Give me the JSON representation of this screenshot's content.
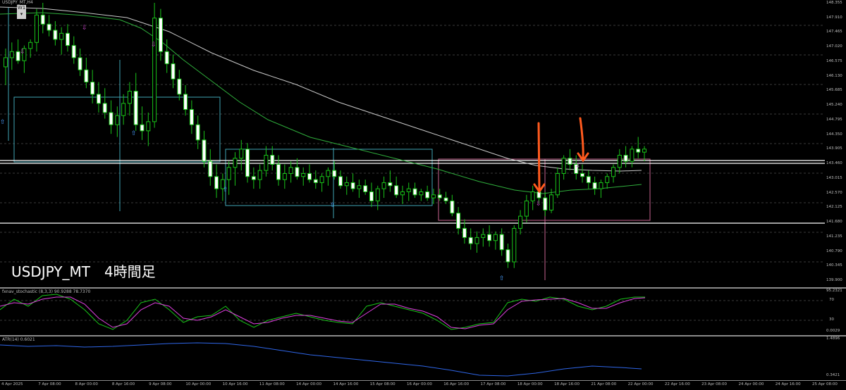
{
  "window": {
    "title": "USDJPY_MT,H4"
  },
  "timeframe": {
    "button_label": "W1"
  },
  "main": {
    "caption": "USDJPY_MT　4時間足",
    "price_labels": [
      "148.355",
      "147.910",
      "147.465",
      "147.020",
      "146.575",
      "146.130",
      "145.685",
      "145.240",
      "144.795",
      "144.350",
      "143.905",
      "143.460",
      "143.015",
      "142.570",
      "142.125",
      "141.680",
      "141.235",
      "140.790",
      "140.345",
      "139.900"
    ]
  },
  "stochastic": {
    "title": "fxnav_stochastic (8,3,3) 90.9288 78.7370",
    "axis_labels": [
      "95.2321",
      "70",
      "30",
      "0.0029"
    ],
    "main_color": "#19c419",
    "signal_color": "#e040e0"
  },
  "atr": {
    "title": "ATR(14) 0.6021",
    "axis_labels": [
      "1.4896",
      "0.3421"
    ],
    "color": "#2f66e8"
  },
  "time_axis": [
    "4 Apr 2025",
    "7 Apr 08:00",
    "8 Apr 00:00",
    "8 Apr 16:00",
    "9 Apr 08:00",
    "10 Apr 00:00",
    "10 Apr 16:00",
    "11 Apr 08:00",
    "14 Apr 00:00",
    "14 Apr 16:00",
    "15 Apr 08:00",
    "16 Apr 00:00",
    "16 Apr 16:00",
    "17 Apr 08:00",
    "18 Apr 00:00",
    "18 Apr 16:00",
    "21 Apr 08:00",
    "22 Apr 00:00",
    "22 Apr 16:00",
    "23 Apr 08:00",
    "24 Apr 00:00",
    "24 Apr 16:00",
    "25 Apr 08:00"
  ],
  "chart_data": {
    "type": "candlestick",
    "symbol": "USDJPY_MT",
    "timeframe": "H4",
    "ylim": [
      139.5,
      148.6
    ],
    "horizontal_levels": [
      143.86,
      143.8,
      141.74
    ],
    "candles": [
      [
        146.5,
        147.1,
        145.9,
        146.8
      ],
      [
        146.8,
        147.3,
        146.4,
        147.0
      ],
      [
        147.0,
        147.4,
        146.6,
        146.7
      ],
      [
        146.7,
        147.2,
        146.3,
        147.1
      ],
      [
        147.1,
        147.4,
        146.8,
        147.3
      ],
      [
        147.3,
        148.4,
        147.0,
        148.2
      ],
      [
        148.2,
        148.6,
        147.6,
        147.9
      ],
      [
        147.9,
        148.2,
        147.5,
        147.7
      ],
      [
        147.7,
        148.0,
        147.2,
        147.4
      ],
      [
        147.4,
        147.8,
        146.9,
        147.6
      ],
      [
        147.6,
        147.9,
        147.0,
        147.2
      ],
      [
        147.2,
        147.5,
        146.6,
        146.8
      ],
      [
        146.8,
        147.1,
        146.2,
        146.4
      ],
      [
        146.4,
        146.8,
        145.8,
        146.0
      ],
      [
        146.0,
        146.4,
        145.3,
        145.6
      ],
      [
        145.6,
        146.0,
        145.0,
        145.3
      ],
      [
        145.3,
        145.8,
        144.8,
        145.0
      ],
      [
        145.0,
        145.4,
        144.3,
        144.6
      ],
      [
        144.6,
        145.2,
        144.2,
        144.9
      ],
      [
        144.9,
        145.6,
        144.6,
        145.3
      ],
      [
        145.3,
        146.0,
        144.9,
        145.7
      ],
      [
        145.7,
        146.3,
        144.4,
        144.6
      ],
      [
        144.6,
        145.2,
        144.1,
        144.4
      ],
      [
        144.4,
        145.0,
        143.9,
        144.7
      ],
      [
        144.7,
        148.6,
        144.5,
        148.1
      ],
      [
        148.1,
        148.4,
        146.7,
        147.0
      ],
      [
        147.0,
        147.4,
        146.3,
        146.6
      ],
      [
        146.6,
        146.9,
        145.8,
        146.1
      ],
      [
        146.1,
        146.4,
        145.4,
        145.6
      ],
      [
        145.6,
        145.9,
        144.9,
        145.1
      ],
      [
        145.1,
        145.4,
        144.3,
        144.6
      ],
      [
        144.6,
        144.9,
        143.8,
        144.1
      ],
      [
        144.1,
        144.4,
        143.2,
        143.4
      ],
      [
        143.4,
        143.8,
        142.6,
        142.9
      ],
      [
        142.9,
        143.3,
        142.2,
        142.5
      ],
      [
        142.5,
        143.0,
        142.1,
        142.8
      ],
      [
        142.8,
        143.4,
        142.3,
        143.2
      ],
      [
        143.2,
        143.7,
        142.6,
        143.5
      ],
      [
        143.5,
        144.1,
        143.1,
        143.8
      ],
      [
        143.8,
        144.0,
        142.7,
        142.9
      ],
      [
        142.9,
        143.2,
        142.5,
        142.8
      ],
      [
        142.8,
        143.3,
        142.5,
        143.1
      ],
      [
        143.1,
        143.9,
        142.9,
        143.6
      ],
      [
        143.6,
        143.9,
        143.1,
        143.3
      ],
      [
        143.3,
        143.6,
        142.6,
        142.8
      ],
      [
        142.8,
        143.3,
        142.5,
        143.0
      ],
      [
        143.0,
        143.4,
        142.7,
        143.2
      ],
      [
        143.2,
        143.5,
        142.8,
        142.9
      ],
      [
        142.9,
        143.2,
        142.6,
        143.0
      ],
      [
        143.0,
        143.3,
        142.7,
        142.8
      ],
      [
        142.8,
        143.1,
        142.5,
        142.7
      ],
      [
        142.7,
        143.0,
        142.4,
        142.9
      ],
      [
        142.9,
        143.2,
        142.6,
        143.1
      ],
      [
        143.1,
        143.4,
        142.8,
        142.9
      ],
      [
        142.9,
        143.1,
        142.5,
        142.6
      ],
      [
        142.6,
        142.9,
        142.3,
        142.7
      ],
      [
        142.7,
        143.0,
        142.4,
        142.5
      ],
      [
        142.5,
        142.8,
        142.2,
        142.6
      ],
      [
        142.6,
        142.8,
        142.3,
        142.4
      ],
      [
        142.4,
        142.7,
        141.9,
        142.1
      ],
      [
        142.1,
        142.6,
        141.8,
        142.5
      ],
      [
        142.5,
        142.9,
        142.2,
        142.7
      ],
      [
        142.7,
        143.1,
        142.4,
        142.6
      ],
      [
        142.6,
        142.9,
        142.2,
        142.3
      ],
      [
        142.3,
        142.6,
        142.0,
        142.4
      ],
      [
        142.4,
        142.7,
        142.1,
        142.5
      ],
      [
        142.5,
        142.7,
        142.2,
        142.3
      ],
      [
        142.3,
        142.5,
        142.1,
        142.4
      ],
      [
        142.4,
        142.6,
        142.1,
        142.2
      ],
      [
        142.2,
        142.5,
        142.0,
        142.3
      ],
      [
        142.3,
        142.5,
        142.1,
        142.2
      ],
      [
        142.2,
        142.4,
        142.0,
        142.1
      ],
      [
        142.1,
        142.3,
        141.6,
        141.7
      ],
      [
        141.7,
        141.9,
        141.0,
        141.2
      ],
      [
        141.2,
        141.5,
        140.7,
        140.9
      ],
      [
        140.9,
        141.2,
        140.5,
        140.7
      ],
      [
        140.7,
        141.1,
        140.4,
        140.9
      ],
      [
        140.9,
        141.2,
        140.6,
        141.0
      ],
      [
        141.0,
        141.3,
        140.6,
        140.8
      ],
      [
        140.8,
        141.1,
        140.5,
        141.0
      ],
      [
        141.0,
        141.2,
        140.3,
        140.5
      ],
      [
        140.5,
        140.7,
        139.9,
        140.1
      ],
      [
        140.1,
        141.3,
        139.9,
        141.2
      ],
      [
        141.2,
        141.8,
        141.0,
        141.6
      ],
      [
        141.6,
        142.3,
        141.4,
        142.1
      ],
      [
        142.1,
        142.6,
        141.8,
        142.4
      ],
      [
        142.4,
        142.8,
        142.0,
        142.2
      ],
      [
        142.2,
        142.4,
        141.6,
        141.8
      ],
      [
        141.8,
        142.5,
        141.7,
        142.3
      ],
      [
        142.3,
        143.2,
        142.2,
        143.0
      ],
      [
        143.0,
        143.6,
        142.8,
        143.5
      ],
      [
        143.5,
        143.8,
        143.1,
        143.3
      ],
      [
        143.3,
        143.6,
        142.8,
        143.0
      ],
      [
        143.0,
        143.3,
        142.7,
        142.9
      ],
      [
        142.9,
        143.1,
        142.5,
        142.7
      ],
      [
        142.7,
        142.9,
        142.3,
        142.5
      ],
      [
        142.5,
        142.8,
        142.2,
        142.7
      ],
      [
        142.7,
        143.0,
        142.5,
        142.9
      ],
      [
        142.9,
        143.3,
        142.7,
        143.2
      ],
      [
        143.2,
        143.8,
        143.0,
        143.6
      ],
      [
        143.6,
        143.9,
        143.2,
        143.4
      ],
      [
        143.4,
        143.9,
        143.2,
        143.8
      ],
      [
        143.8,
        144.2,
        143.5,
        143.7
      ],
      [
        143.7,
        143.9,
        143.4,
        143.8
      ]
    ]
  }
}
